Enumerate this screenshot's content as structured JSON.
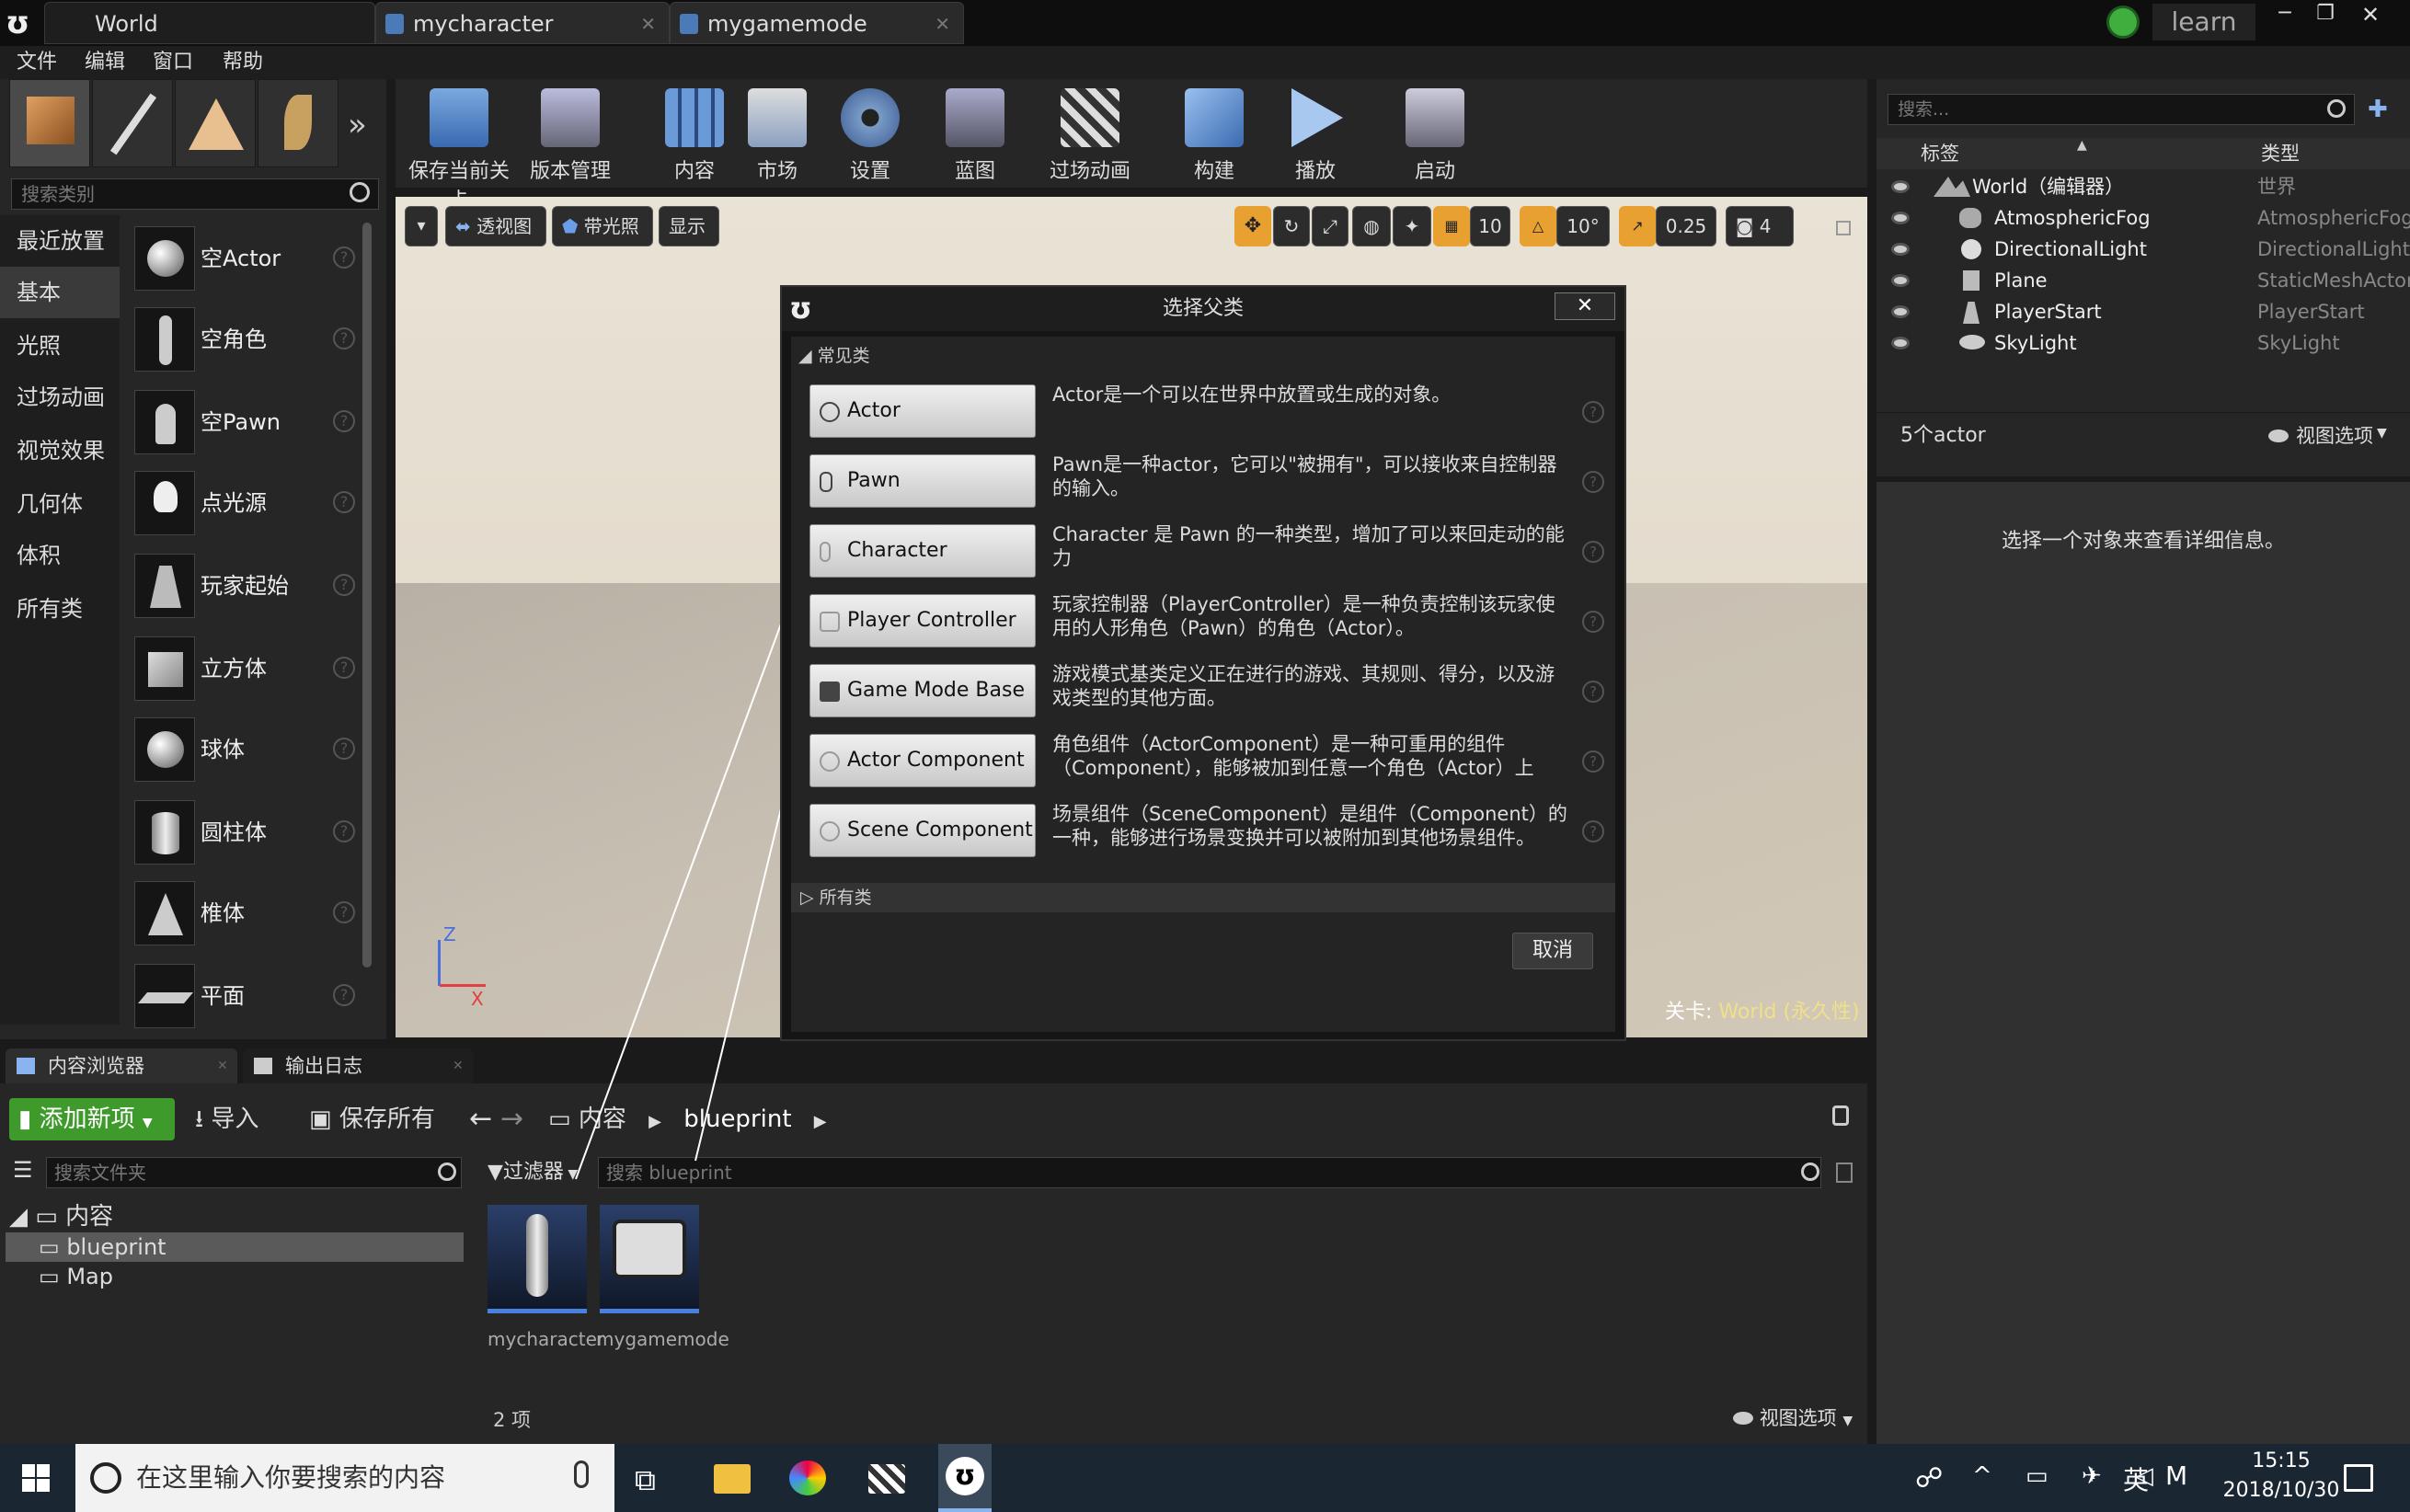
{
  "window": {
    "tabs": [
      {
        "label": "World"
      },
      {
        "label": "mycharacter"
      },
      {
        "label": "mygamemode"
      }
    ],
    "user": "learn",
    "controls": [
      "─",
      "❐",
      "✕"
    ]
  },
  "menu": [
    "文件",
    "编辑",
    "窗口",
    "帮助"
  ],
  "modes": {
    "search_placeholder": "搜索类别",
    "categories": [
      "最近放置",
      "基本",
      "光照",
      "过场动画",
      "视觉效果",
      "几何体",
      "体积",
      "所有类"
    ],
    "selected_category": "基本",
    "items": [
      "空Actor",
      "空角色",
      "空Pawn",
      "点光源",
      "玩家起始",
      "立方体",
      "球体",
      "圆柱体",
      "椎体",
      "平面"
    ]
  },
  "toolbar": {
    "items": [
      "保存当前关卡",
      "版本管理",
      "内容",
      "市场",
      "设置",
      "蓝图",
      "过场动画",
      "构建",
      "播放",
      "启动"
    ]
  },
  "viewport": {
    "buttons": [
      "透视图",
      "带光照",
      "显示"
    ],
    "snap_grid": "10",
    "snap_rot": "10°",
    "snap_scale": "0.25",
    "cam_speed": "4",
    "level_prefix": "关卡:",
    "level_name": "World (永久性)",
    "axis_z": "Z",
    "axis_x": "X"
  },
  "dialog": {
    "title": "选择父类",
    "section_common": "常见类",
    "section_all": "所有类",
    "cancel": "取消",
    "classes": [
      {
        "name": "Actor",
        "desc": "Actor是一个可以在世界中放置或生成的对象。"
      },
      {
        "name": "Pawn",
        "desc": "Pawn是一种actor，它可以\"被拥有\"，可以接收来自控制器的输入。"
      },
      {
        "name": "Character",
        "desc": "Character 是 Pawn 的一种类型，增加了可以来回走动的能力"
      },
      {
        "name": "Player Controller",
        "desc": "玩家控制器（PlayerController）是一种负责控制该玩家使用的人形角色（Pawn）的角色（Actor）。"
      },
      {
        "name": "Game Mode Base",
        "desc": "游戏模式基类定义正在进行的游戏、其规则、得分，以及游戏类型的其他方面。"
      },
      {
        "name": "Actor Component",
        "desc": "角色组件（ActorComponent）是一种可重用的组件（Component），能够被加到任意一个角色（Actor）上"
      },
      {
        "name": "Scene Component",
        "desc": "场景组件（SceneComponent）是组件（Component）的一种，能够进行场景变换并可以被附加到其他场景组件。"
      }
    ]
  },
  "outliner": {
    "search_placeholder": "搜索...",
    "col_label": "标签",
    "col_type": "类型",
    "rows": [
      {
        "label": "World（编辑器）",
        "type": "世界"
      },
      {
        "label": "AtmosphericFog",
        "type": "AtmosphericFog"
      },
      {
        "label": "DirectionalLight",
        "type": "DirectionalLight"
      },
      {
        "label": "Plane",
        "type": "StaticMeshActor"
      },
      {
        "label": "PlayerStart",
        "type": "PlayerStart"
      },
      {
        "label": "SkyLight",
        "type": "SkyLight"
      }
    ],
    "count": "5个actor",
    "view_options": "视图选项"
  },
  "details": {
    "hint": "选择一个对象来查看详细信息。"
  },
  "content_browser": {
    "tabs": [
      "内容浏览器",
      "输出日志"
    ],
    "add_new": "添加新项",
    "import": "导入",
    "save_all": "保存所有",
    "path": [
      "内容",
      "blueprint"
    ],
    "folder_search_placeholder": "搜索文件夹",
    "filters": "过滤器",
    "asset_search_placeholder": "搜索 blueprint",
    "tree": [
      "内容",
      "blueprint",
      "Map"
    ],
    "assets": [
      "mycharacter",
      "mygamemode"
    ],
    "item_count": "2 项",
    "view_options": "视图选项"
  },
  "taskbar": {
    "search_placeholder": "在这里输入你要搜索的内容",
    "ime": "英",
    "time": "15:15",
    "date": "2018/10/30"
  },
  "colors": {
    "accent_orange": "#e8a030",
    "add_green": "#3f9a2c",
    "taskbar": "#1b2633"
  }
}
